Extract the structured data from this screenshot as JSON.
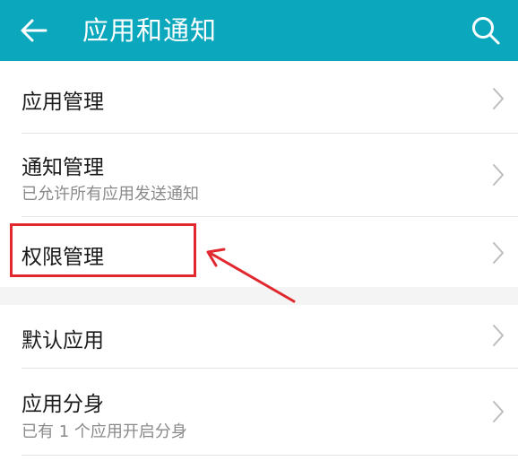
{
  "header": {
    "title": "应用和通知",
    "back_icon": "arrow-left-icon",
    "search_icon": "search-icon",
    "background_color": "#0aa7bd"
  },
  "groups": [
    {
      "items": [
        {
          "title": "应用管理",
          "subtitle": ""
        },
        {
          "title": "通知管理",
          "subtitle": "已允许所有应用发送通知"
        },
        {
          "title": "权限管理",
          "subtitle": ""
        }
      ]
    },
    {
      "items": [
        {
          "title": "默认应用",
          "subtitle": ""
        },
        {
          "title": "应用分身",
          "subtitle": "已有 1 个应用开启分身"
        }
      ]
    }
  ],
  "annotation": {
    "highlight_color": "#e0282e",
    "highlighted_item": "权限管理"
  }
}
